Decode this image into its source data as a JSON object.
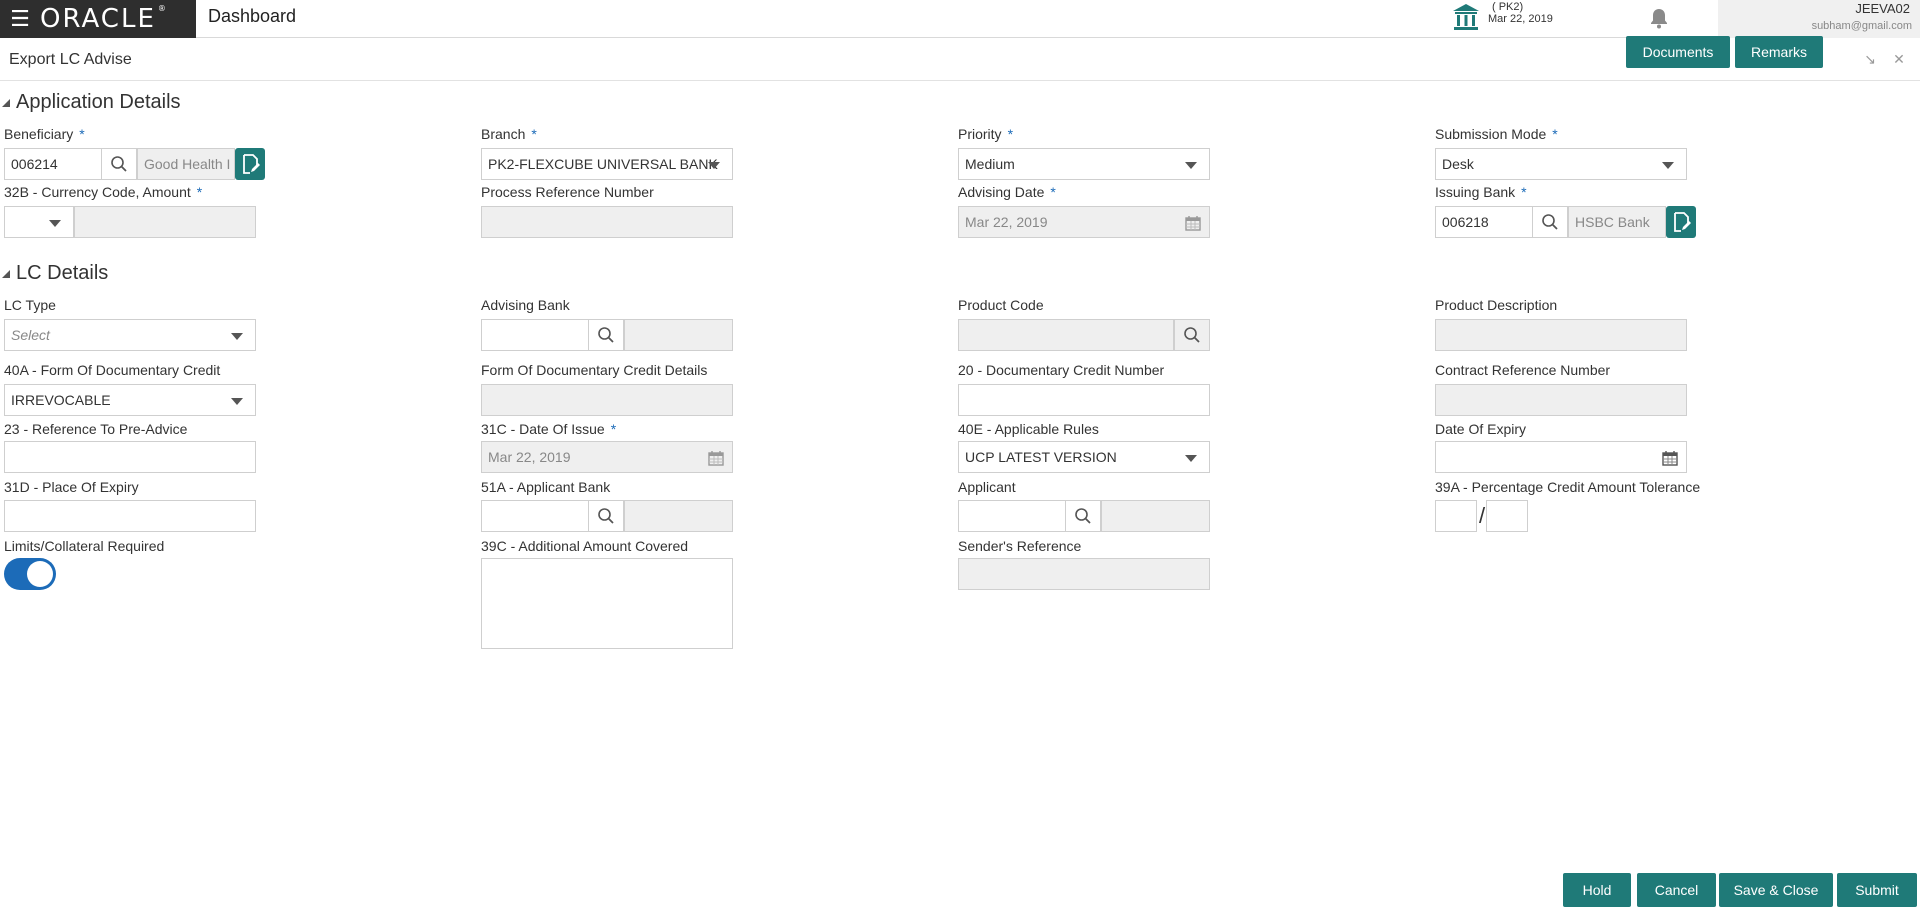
{
  "header": {
    "logo_text": "ORACLE",
    "logo_mark": "®",
    "dashboard_label": "Dashboard",
    "branch_code": "( PK2)",
    "branch_date": "Mar 22, 2019",
    "user_name": "JEEVA02",
    "user_email": "subham@gmail.com"
  },
  "subheader": {
    "title": "Export LC Advise",
    "documents_label": "Documents",
    "remarks_label": "Remarks"
  },
  "application_details": {
    "section_title": "Application Details",
    "beneficiary": {
      "label": "Beneficiary",
      "value": "006214",
      "name_value": "Good Health I"
    },
    "branch": {
      "label": "Branch",
      "value": "PK2-FLEXCUBE UNIVERSAL BANK"
    },
    "priority": {
      "label": "Priority",
      "value": "Medium"
    },
    "submission_mode": {
      "label": "Submission Mode",
      "value": "Desk"
    },
    "currency_amount": {
      "label": "32B - Currency Code, Amount",
      "value": ""
    },
    "process_reference": {
      "label": "Process Reference Number",
      "value": ""
    },
    "advising_date": {
      "label": "Advising Date",
      "value": "Mar 22, 2019"
    },
    "issuing_bank": {
      "label": "Issuing Bank",
      "value": "006218",
      "name_value": "HSBC Bank"
    }
  },
  "lc_details": {
    "section_title": "LC Details",
    "lc_type": {
      "label": "LC Type",
      "placeholder": "Select"
    },
    "advising_bank": {
      "label": "Advising Bank"
    },
    "product_code": {
      "label": "Product Code"
    },
    "product_description": {
      "label": "Product Description"
    },
    "form_of_credit": {
      "label": "40A - Form Of Documentary Credit",
      "value": "IRREVOCABLE"
    },
    "form_of_credit_details": {
      "label": "Form Of Documentary Credit Details"
    },
    "credit_number": {
      "label": "20 - Documentary Credit Number"
    },
    "contract_reference": {
      "label": "Contract Reference Number"
    },
    "pre_advice": {
      "label": "23 - Reference To Pre-Advice"
    },
    "date_of_issue": {
      "label": "31C - Date Of Issue",
      "value": "Mar 22, 2019"
    },
    "applicable_rules": {
      "label": "40E - Applicable Rules",
      "value": "UCP LATEST VERSION"
    },
    "date_of_expiry": {
      "label": "Date Of Expiry"
    },
    "place_of_expiry": {
      "label": "31D - Place Of Expiry"
    },
    "applicant_bank": {
      "label": "51A - Applicant Bank"
    },
    "applicant": {
      "label": "Applicant"
    },
    "tolerance": {
      "label": "39A - Percentage Credit Amount Tolerance",
      "separator": "/"
    },
    "limits_required": {
      "label": "Limits/Collateral Required",
      "enabled": true
    },
    "additional_amount": {
      "label": "39C - Additional Amount Covered"
    },
    "senders_reference": {
      "label": "Sender's Reference"
    }
  },
  "footer": {
    "hold_label": "Hold",
    "cancel_label": "Cancel",
    "save_close_label": "Save & Close",
    "submit_label": "Submit"
  },
  "colors": {
    "teal_button": "#1f7a78",
    "toggle_blue": "#1c6bb8",
    "header_dark": "#2e2e2e",
    "required_star": "#1c6bb8"
  }
}
